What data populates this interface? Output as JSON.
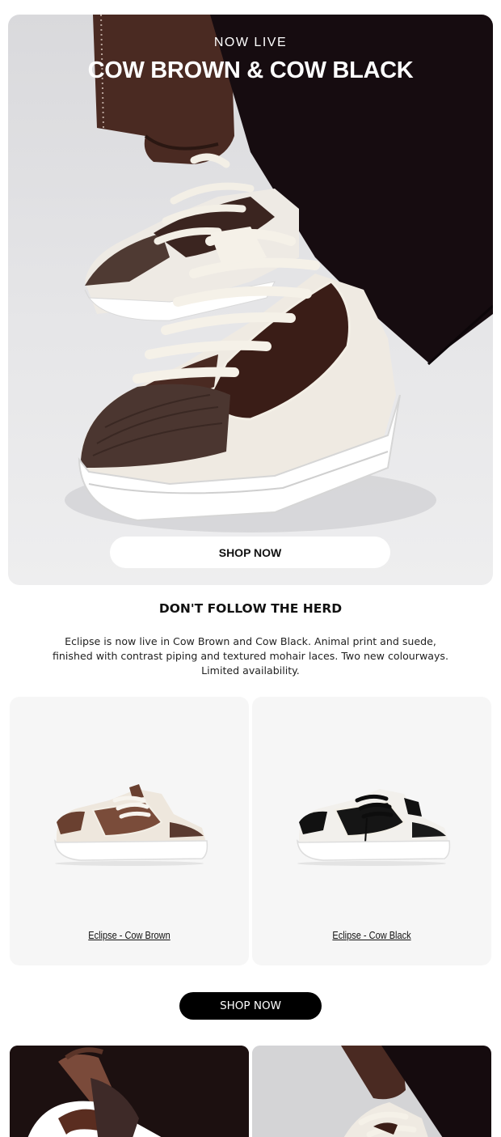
{
  "hero": {
    "eyebrow": "NOW LIVE",
    "title": "COW BROWN & COW BLACK",
    "button_label": "SHOP NOW"
  },
  "intro": {
    "headline": "DON'T FOLLOW THE HERD",
    "body": "Eclipse is now live in Cow Brown and Cow Black. Animal print and suede, finished with contrast piping and textured mohair laces. Two new colourways. Limited availability."
  },
  "products": [
    {
      "name": "Eclipse - Cow Brown",
      "image_icon": "sneaker-cow-brown-image"
    },
    {
      "name": "Eclipse - Cow Black",
      "image_icon": "sneaker-cow-black-image"
    }
  ],
  "cta": {
    "button_label": "SHOP NOW"
  },
  "colors": {
    "accent": "#000000",
    "card_bg": "#f6f6f6",
    "cow_brown": "#4a2a22",
    "cream": "#f1ece2"
  }
}
